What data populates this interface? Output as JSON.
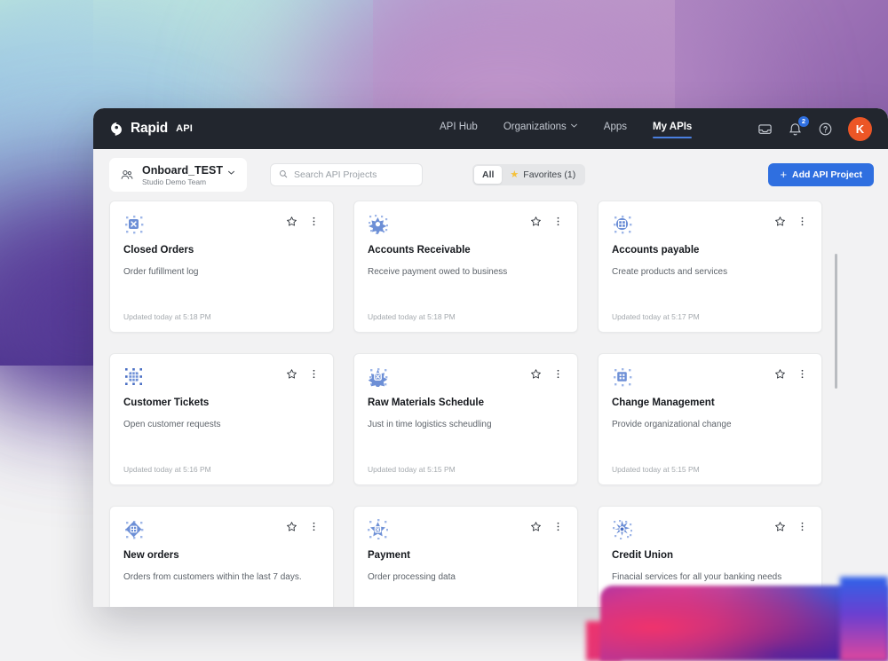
{
  "brand": {
    "name": "Rapid",
    "suffix": "API",
    "logo_icon": "rapidapi-logo-icon",
    "accent_blue": "#2f6fe0",
    "nav_bg": "#22262e",
    "avatar_color": "#ec5626"
  },
  "nav": {
    "links": [
      {
        "label": "API Hub",
        "active": false,
        "has_chevron": false
      },
      {
        "label": "Organizations",
        "active": false,
        "has_chevron": true
      },
      {
        "label": "Apps",
        "active": false,
        "has_chevron": false
      },
      {
        "label": "My APIs",
        "active": true,
        "has_chevron": false
      }
    ],
    "icons": [
      {
        "name": "inbox-icon",
        "badge": null
      },
      {
        "name": "bell-icon",
        "badge": "2"
      },
      {
        "name": "help-circle-icon",
        "badge": null
      }
    ],
    "avatar_initial": "K"
  },
  "toolbar": {
    "team": {
      "icon": "people-icon",
      "name": "Onboard_TEST",
      "subtitle": "Studio Demo Team",
      "chevron": "chevron-down-icon"
    },
    "search": {
      "icon": "search-icon",
      "placeholder": "Search API Projects",
      "value": ""
    },
    "filters": [
      {
        "label": "All",
        "active": true,
        "star": false
      },
      {
        "label": "Favorites (1)",
        "active": false,
        "star": true
      }
    ],
    "add_button": {
      "label": "Add API Project",
      "icon": "plus-icon"
    }
  },
  "cards": [
    {
      "icon": "chip-closed-orders-icon",
      "title": "Closed Orders",
      "description": "Order fufillment log",
      "updated": "Updated today at 5:18 PM",
      "favorite": false
    },
    {
      "icon": "chip-accounts-receivable-icon",
      "title": "Accounts Receivable",
      "description": "Receive payment owed to business",
      "updated": "Updated today at 5:18 PM",
      "favorite": false
    },
    {
      "icon": "chip-accounts-payable-icon",
      "title": "Accounts payable",
      "description": "Create products and services",
      "updated": "Updated today at 5:17 PM",
      "favorite": false
    },
    {
      "icon": "chip-customer-tickets-icon",
      "title": "Customer Tickets",
      "description": "Open customer requests",
      "updated": "Updated today at 5:16 PM",
      "favorite": false
    },
    {
      "icon": "chip-raw-materials-icon",
      "title": "Raw Materials Schedule",
      "description": "Just in time logistics scheudling",
      "updated": "Updated today at 5:15 PM",
      "favorite": false
    },
    {
      "icon": "chip-change-management-icon",
      "title": "Change Management",
      "description": "Provide organizational change",
      "updated": "Updated today at 5:15 PM",
      "favorite": false
    },
    {
      "icon": "chip-new-orders-icon",
      "title": "New orders",
      "description": "Orders from customers within the last 7 days.",
      "updated": "",
      "favorite": false
    },
    {
      "icon": "chip-payment-icon",
      "title": "Payment",
      "description": "Order processing data",
      "updated": "",
      "favorite": false
    },
    {
      "icon": "chip-credit-union-icon",
      "title": "Credit Union",
      "description": "Finacial services for all your banking needs",
      "updated": "",
      "favorite": false
    }
  ]
}
